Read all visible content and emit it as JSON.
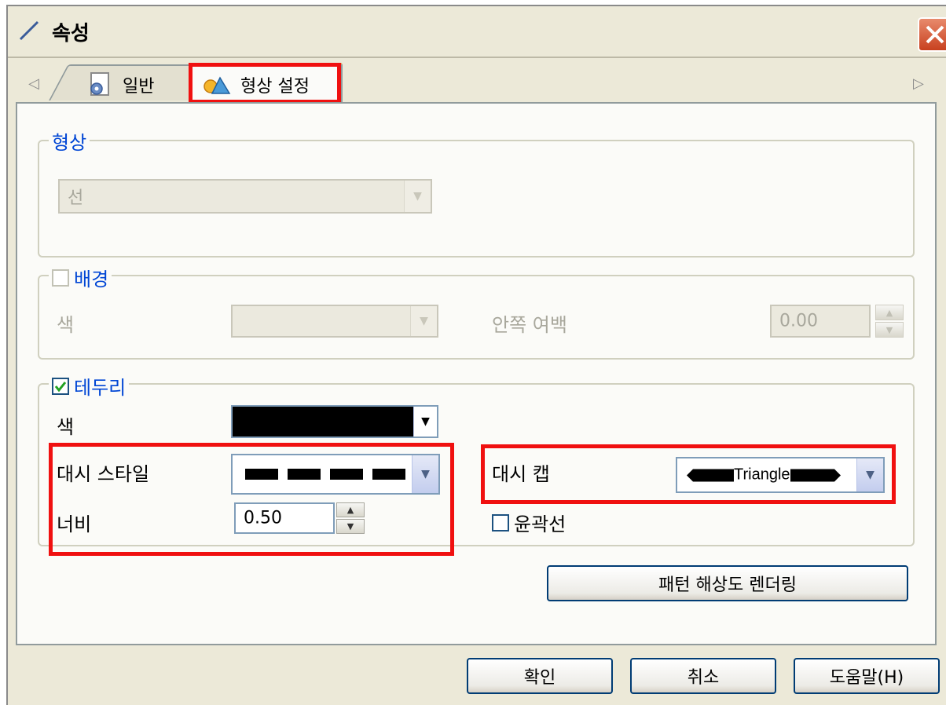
{
  "window": {
    "title": "속성",
    "close_label": "X"
  },
  "tabs": [
    {
      "label": "일반"
    },
    {
      "label": "형상 설정"
    }
  ],
  "shape_group": {
    "legend": "형상",
    "type_value": "선"
  },
  "background_group": {
    "legend": "배경",
    "checked": false,
    "color_label": "색",
    "padding_label": "안쪽 여백",
    "padding_value": "0.00"
  },
  "border_group": {
    "legend": "테두리",
    "checked": true,
    "color_label": "색",
    "color_value": "#000000",
    "dash_style_label": "대시 스타일",
    "width_label": "너비",
    "width_value": "0.50",
    "dash_cap_label": "대시 캡",
    "dash_cap_value": "Triangle",
    "outline_label": "윤곽선",
    "outline_checked": false
  },
  "render_button": "패턴 해상도 렌더링",
  "footer": {
    "ok": "확인",
    "cancel": "취소",
    "help": "도움말(H)"
  },
  "colors": {
    "highlight": "#f01010",
    "legend_text": "#0046d5"
  }
}
